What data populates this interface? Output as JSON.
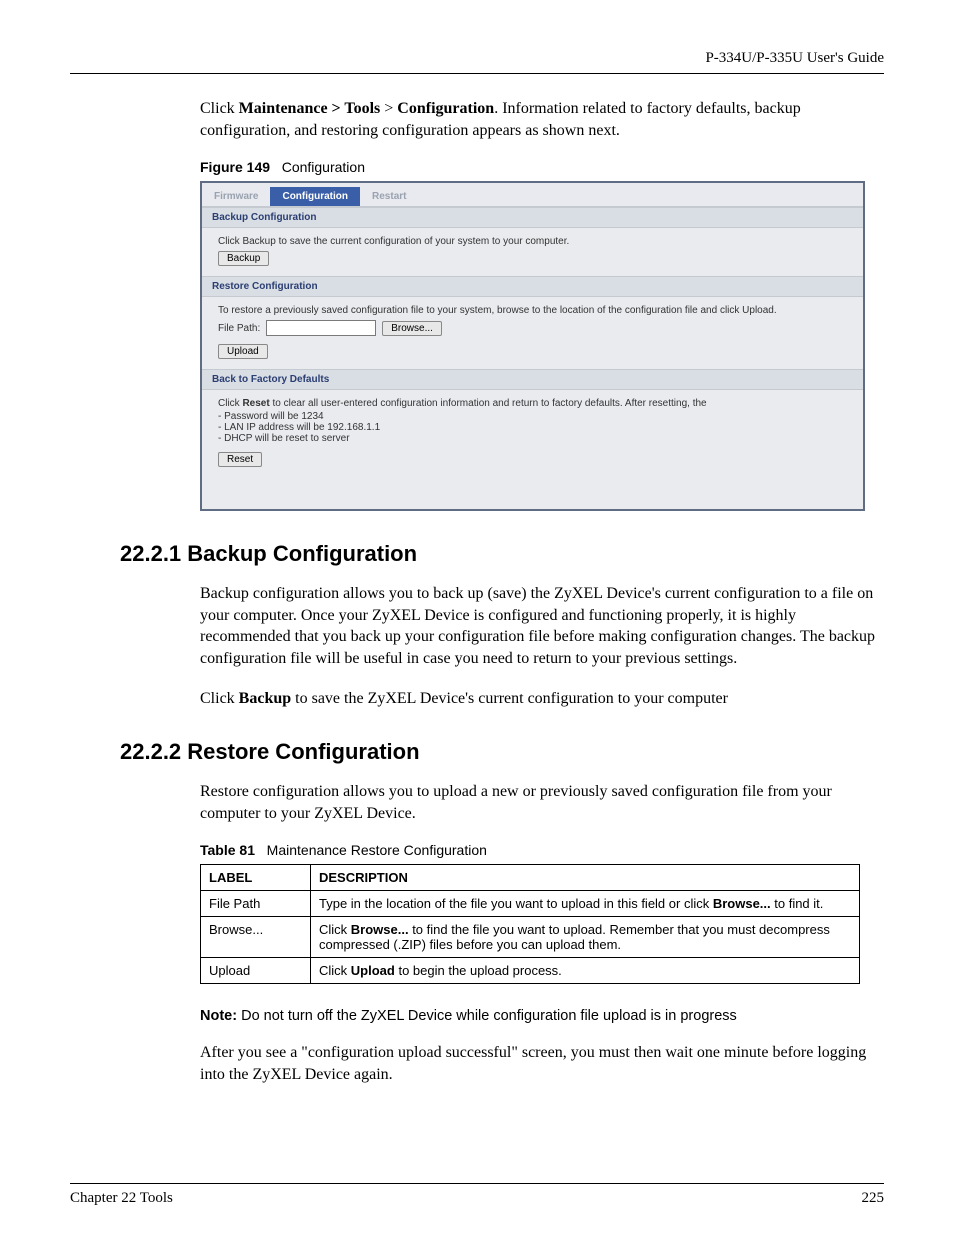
{
  "header": {
    "guide": "P-334U/P-335U User's Guide"
  },
  "intro": {
    "pre": "Click ",
    "bold1": "Maintenance > Tools",
    "mid": " > ",
    "bold2": "Configuration",
    "post": ". Information related to factory defaults, backup configuration, and restoring configuration appears as shown next."
  },
  "fig": {
    "label": "Figure 149",
    "title": "Configuration"
  },
  "shot": {
    "tabs": {
      "firmware": "Firmware",
      "configuration": "Configuration",
      "restart": "Restart"
    },
    "backup": {
      "title": "Backup Configuration",
      "text": "Click Backup to save the current configuration of your system to your computer.",
      "btn": "Backup"
    },
    "restore": {
      "title": "Restore Configuration",
      "text": "To restore a previously saved configuration file to your system, browse to the location of the configuration file and click Upload.",
      "filepath_label": "File Path:",
      "browse_btn": "Browse...",
      "upload_btn": "Upload"
    },
    "factory": {
      "title": "Back to Factory Defaults",
      "text_pre": "Click ",
      "text_bold": "Reset",
      "text_post": " to clear all user-entered configuration information and return to factory defaults. After resetting, the",
      "li1": "Password will be 1234",
      "li2": "LAN IP address will be 192.168.1.1",
      "li3": "DHCP will be reset to server",
      "btn": "Reset"
    }
  },
  "sec_backup": {
    "heading": "22.2.1  Backup Configuration",
    "p1": "Backup configuration allows you to back up (save) the ZyXEL Device's current configuration to a file on your computer. Once your ZyXEL Device is configured and functioning properly, it is highly recommended that you back up your configuration file before making configuration changes. The backup configuration file will be useful in case you need to return to your previous settings.",
    "p2_pre": "Click ",
    "p2_bold": "Backup",
    "p2_post": " to save the ZyXEL Device's current configuration to your computer"
  },
  "sec_restore": {
    "heading": "22.2.2  Restore Configuration",
    "p1": "Restore configuration allows you to upload a new or previously saved configuration file from your computer to your ZyXEL Device."
  },
  "table": {
    "caption_label": "Table 81",
    "caption_title": "Maintenance Restore Configuration",
    "col1": "LABEL",
    "col2": "DESCRIPTION",
    "rows": [
      {
        "label": "File Path",
        "desc_pre": "Type in the location of the file you want to upload in this field or click ",
        "desc_bold": "Browse...",
        "desc_post": " to find it."
      },
      {
        "label": "Browse...",
        "desc_pre": "Click ",
        "desc_bold": "Browse...",
        "desc_post": " to find the file you want to upload. Remember that you must decompress compressed (.ZIP) files before you can upload them."
      },
      {
        "label": "Upload",
        "desc_pre": "Click ",
        "desc_bold": "Upload",
        "desc_post": " to begin the upload process."
      }
    ]
  },
  "note": {
    "label": "Note:",
    "text": " Do not turn off the ZyXEL Device while configuration file upload is in progress"
  },
  "after_note": "After you see a \"configuration upload successful\" screen, you must then wait one minute before logging into the ZyXEL Device again.",
  "footer": {
    "left": "Chapter 22 Tools",
    "right": "225"
  }
}
